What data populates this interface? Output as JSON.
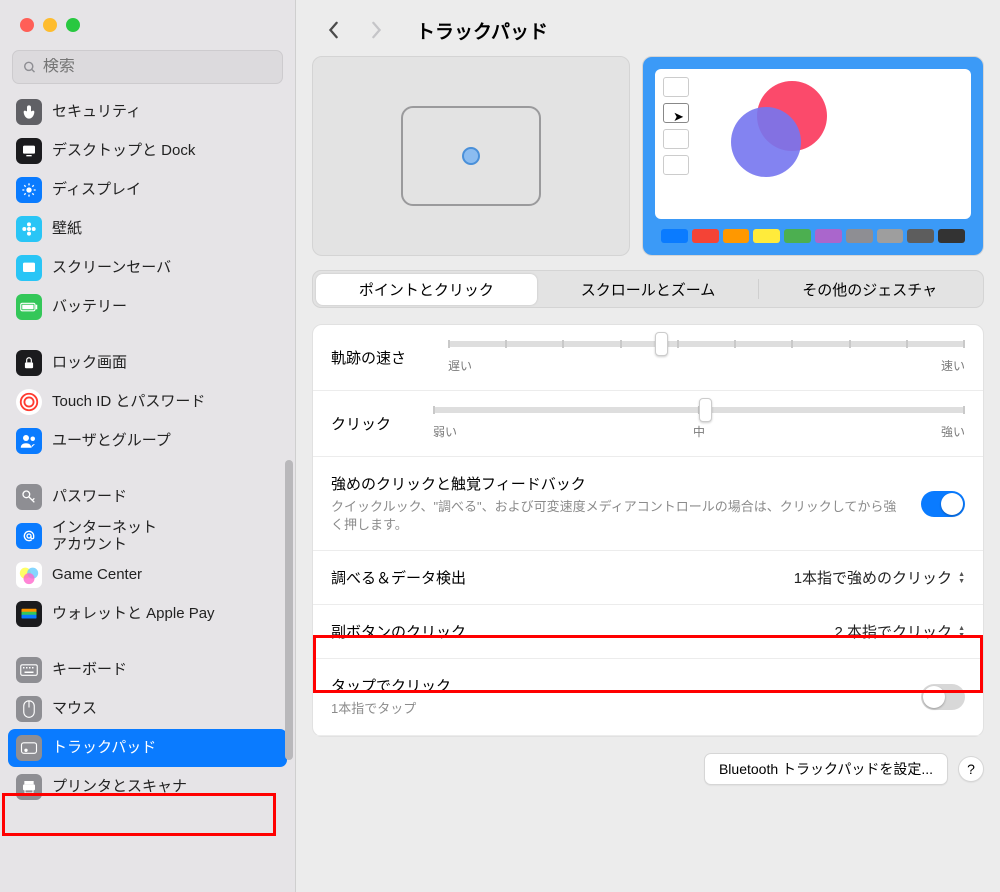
{
  "header": {
    "title": "トラックパッド"
  },
  "search": {
    "placeholder": "検索"
  },
  "sidebar": {
    "items": [
      {
        "label": "セキュリティ",
        "icon_bg": "#606065",
        "icon": "hand"
      },
      {
        "label": "デスクトップと Dock",
        "icon_bg": "#1b1b1e",
        "icon": "desktop"
      },
      {
        "label": "ディスプレイ",
        "icon_bg": "#0a7bff",
        "icon": "display"
      },
      {
        "label": "壁紙",
        "icon_bg": "#29c5f6",
        "icon": "flower"
      },
      {
        "label": "スクリーンセーバ",
        "icon_bg": "#29c5f6",
        "icon": "screensaver"
      },
      {
        "label": "バッテリー",
        "icon_bg": "#34c759",
        "icon": "battery"
      },
      {
        "label": "ロック画面",
        "icon_bg": "#1b1b1e",
        "icon": "lock"
      },
      {
        "label": "Touch ID とパスワード",
        "icon_bg": "#ffffff",
        "icon": "touchid",
        "round": true
      },
      {
        "label": "ユーザとグループ",
        "icon_bg": "#0a7bff",
        "icon": "users"
      },
      {
        "label": "パスワード",
        "icon_bg": "#8e8e93",
        "icon": "key"
      },
      {
        "label": "インターネット\nアカウント",
        "icon_bg": "#0a7bff",
        "icon": "at"
      },
      {
        "label": "Game Center",
        "icon_bg": "#ffffff",
        "icon": "gamecenter"
      },
      {
        "label": "ウォレットと Apple Pay",
        "icon_bg": "#1b1b1e",
        "icon": "wallet"
      },
      {
        "label": "キーボード",
        "icon_bg": "#8e8e93",
        "icon": "keyboard"
      },
      {
        "label": "マウス",
        "icon_bg": "#8e8e93",
        "icon": "mouse"
      },
      {
        "label": "トラックパッド",
        "icon_bg": "#8e8e93",
        "icon": "trackpad",
        "selected": true
      },
      {
        "label": "プリンタとスキャナ",
        "icon_bg": "#8e8e93",
        "icon": "printer"
      }
    ]
  },
  "tabs": {
    "items": [
      {
        "label": "ポイントとクリック",
        "active": true
      },
      {
        "label": "スクロールとズーム"
      },
      {
        "label": "その他のジェスチャ"
      }
    ]
  },
  "rows": {
    "tracking": {
      "label": "軌跡の速さ",
      "min_label": "遅い",
      "max_label": "速い",
      "value_pct": 40
    },
    "click": {
      "label": "クリック",
      "min_label": "弱い",
      "mid_label": "中",
      "max_label": "強い",
      "value_pct": 50
    },
    "force": {
      "label": "強めのクリックと触覚フィードバック",
      "sub": "クイックルック、\"調べる\"、および可変速度メディアコントロールの場合は、クリックしてから強く押します。",
      "on": true
    },
    "lookup": {
      "label": "調べる＆データ検出",
      "value": "1本指で強めのクリック"
    },
    "secondary": {
      "label": "副ボタンのクリック",
      "value": "2 本指でクリック"
    },
    "tap": {
      "label": "タップでクリック",
      "sub": "1本指でタップ",
      "on": false
    }
  },
  "footer": {
    "bt_button": "Bluetooth トラックパッドを設定...",
    "help": "?"
  },
  "palette_colors": [
    "#0a7bff",
    "#f44336",
    "#ff9800",
    "#ffeb3b",
    "#4caf50",
    "#aa66cc",
    "#8e8e93",
    "#9e9e9e",
    "#5d5d5d",
    "#333"
  ]
}
